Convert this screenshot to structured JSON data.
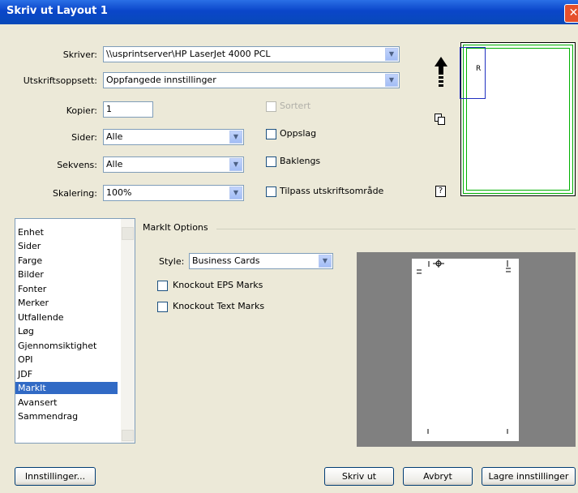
{
  "window": {
    "title": "Skriv ut Layout 1"
  },
  "printer": {
    "label": "Skriver:",
    "value": "\\\\usprintserver\\HP LaserJet 4000 PCL"
  },
  "preset": {
    "label": "Utskriftsoppsett:",
    "value": "Oppfangede innstillinger"
  },
  "copies": {
    "label": "Kopier:",
    "value": "1"
  },
  "pages": {
    "label": "Sider:",
    "value": "Alle"
  },
  "sequence": {
    "label": "Sekvens:",
    "value": "Alle"
  },
  "scaling": {
    "label": "Skalering:",
    "value": "100%"
  },
  "checkboxes": {
    "collate": {
      "label": "Sortert",
      "checked": false,
      "disabled": true
    },
    "spreads": {
      "label": "Oppslag",
      "checked": false
    },
    "reverse": {
      "label": "Baklengs",
      "checked": false
    },
    "fit": {
      "label": "Tilpass utskriftsområde",
      "checked": false
    }
  },
  "preview": {
    "page_letter": "R",
    "help": "?"
  },
  "categories": {
    "items": [
      "Enhet",
      "Sider",
      "Farge",
      "Bilder",
      "Fonter",
      "Merker",
      "Utfallende",
      "Løg",
      "Gjennomsiktighet",
      "OPI",
      "JDF",
      "MarkIt",
      "Avansert",
      "Sammendrag"
    ],
    "selected": "MarkIt"
  },
  "markit": {
    "group_title": "MarkIt Options",
    "style_label": "Style:",
    "style_value": "Business Cards",
    "knockout_eps": "Knockout EPS Marks",
    "knockout_text": "Knockout Text Marks"
  },
  "buttons": {
    "settings": "Innstillinger...",
    "print": "Skriv ut",
    "cancel": "Avbryt",
    "save": "Lagre innstillinger"
  },
  "colors": {
    "titlebar": "#0a46c9",
    "selection": "#316ac5",
    "preview_bleed": "#00b000",
    "preview_page": "#2030c0"
  }
}
